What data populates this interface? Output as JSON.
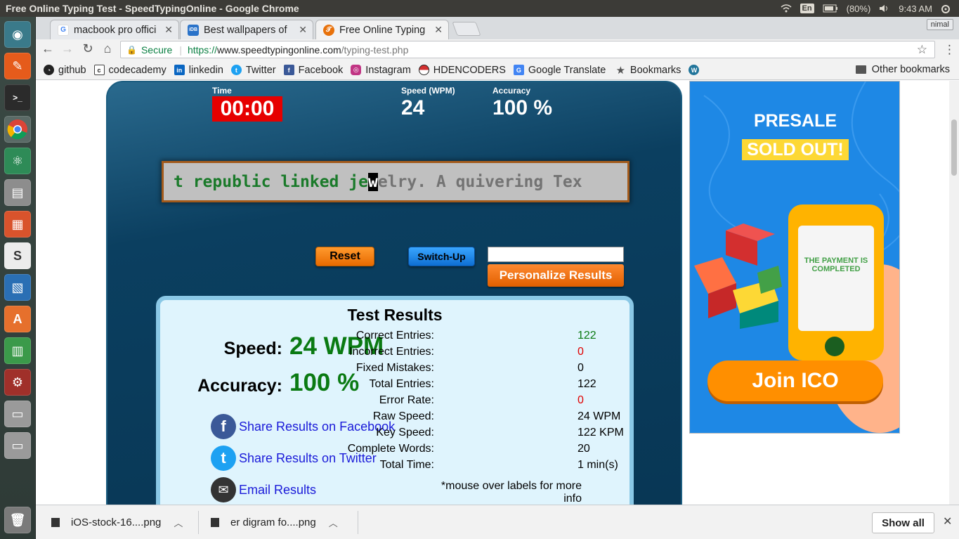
{
  "window": {
    "title": "Free Online Typing Test - SpeedTypingOnline - Google Chrome"
  },
  "tray": {
    "lang": "En",
    "battery": "(80%)",
    "time": "9:43 AM"
  },
  "tabs": [
    {
      "label": "macbook pro offici",
      "favicon": "google-icon",
      "color": "#4285f4"
    },
    {
      "label": "Best wallpapers of",
      "favicon": "idb-icon",
      "color": "#2a73c9"
    },
    {
      "label": "Free Online Typing",
      "favicon": "speedtyping-icon",
      "color": "#e8710a"
    }
  ],
  "profile": "nimal",
  "address": {
    "secure_label": "Secure",
    "scheme": "https://",
    "host": "www.speedtypingonline.com",
    "path": "/typing-test.php"
  },
  "bookmarks": [
    {
      "label": "github",
      "icon": "github-icon",
      "color": "#222"
    },
    {
      "label": "codecademy",
      "icon": "codecademy-icon",
      "color": "#444"
    },
    {
      "label": "linkedin",
      "icon": "linkedin-icon",
      "color": "#0a66c2"
    },
    {
      "label": "Twitter",
      "icon": "twitter-icon",
      "color": "#1da1f2"
    },
    {
      "label": "Facebook",
      "icon": "facebook-icon",
      "color": "#3b5998"
    },
    {
      "label": "Instagram",
      "icon": "instagram-icon",
      "color": "#c13584"
    },
    {
      "label": "HDENCODERS",
      "icon": "pokeball-icon",
      "color": "#d32f2f"
    },
    {
      "label": "Google Translate",
      "icon": "translate-icon",
      "color": "#4285f4"
    },
    {
      "label": "Bookmarks",
      "icon": "star-icon",
      "color": "#555"
    },
    {
      "label": "",
      "icon": "wordpress-icon",
      "color": "#21759b"
    }
  ],
  "other_bookmarks": "Other bookmarks",
  "test": {
    "time_label": "Time",
    "time_value": "00:00",
    "speed_label": "Speed (WPM)",
    "speed_value": "24",
    "accuracy_label": "Accuracy",
    "accuracy_value": "100 %",
    "typed_text": "t republic linked je",
    "cursor_char": "w",
    "remaining_text": "elry. A quivering Tex",
    "reset_label": "Reset",
    "switch_label": "Switch-Up",
    "name_input_value": "",
    "personalize_label": "Personalize Results"
  },
  "results": {
    "heading": "Test Results",
    "speed_label": "Speed:",
    "speed_value": "24 WPM",
    "accuracy_label": "Accuracy:",
    "accuracy_value": "100 %",
    "share": [
      {
        "label": "Share Results on Facebook",
        "icon": "facebook-icon",
        "color": "#3b5998",
        "glyph": "f"
      },
      {
        "label": "Share Results on Twitter",
        "icon": "twitter-icon",
        "color": "#1da1f2",
        "glyph": "t"
      },
      {
        "label": "Email Results",
        "icon": "email-icon",
        "color": "#333333",
        "glyph": "✉"
      }
    ],
    "stats": [
      {
        "k": "Correct Entries:",
        "v": "122",
        "color": "#0a7a12"
      },
      {
        "k": "Incorrect Entries:",
        "v": "0",
        "color": "#e00000"
      },
      {
        "k": "Fixed Mistakes:",
        "v": "0",
        "color": "#000000"
      },
      {
        "k": "Total Entries:",
        "v": "122",
        "color": "#000000"
      },
      {
        "k": "Error Rate:",
        "v": "0",
        "color": "#e00000"
      },
      {
        "k": "Raw Speed:",
        "v": "24 WPM",
        "color": "#000000"
      },
      {
        "k": "Key Speed:",
        "v": "122 KPM",
        "color": "#000000"
      },
      {
        "k": "Complete Words:",
        "v": "20",
        "color": "#000000"
      },
      {
        "k": "Total Time:",
        "v": "1 min(s)",
        "color": "#000000"
      }
    ],
    "note": "*mouse over labels for more info"
  },
  "ad": {
    "presale": "PRESALE",
    "sold_out": "SOLD OUT!",
    "payment": "THE PAYMENT IS COMPLETED",
    "join": "Join ICO"
  },
  "downloads": {
    "items": [
      {
        "label": "iOS-stock-16....png"
      },
      {
        "label": "er digram fo....png"
      }
    ],
    "show_all": "Show all"
  }
}
